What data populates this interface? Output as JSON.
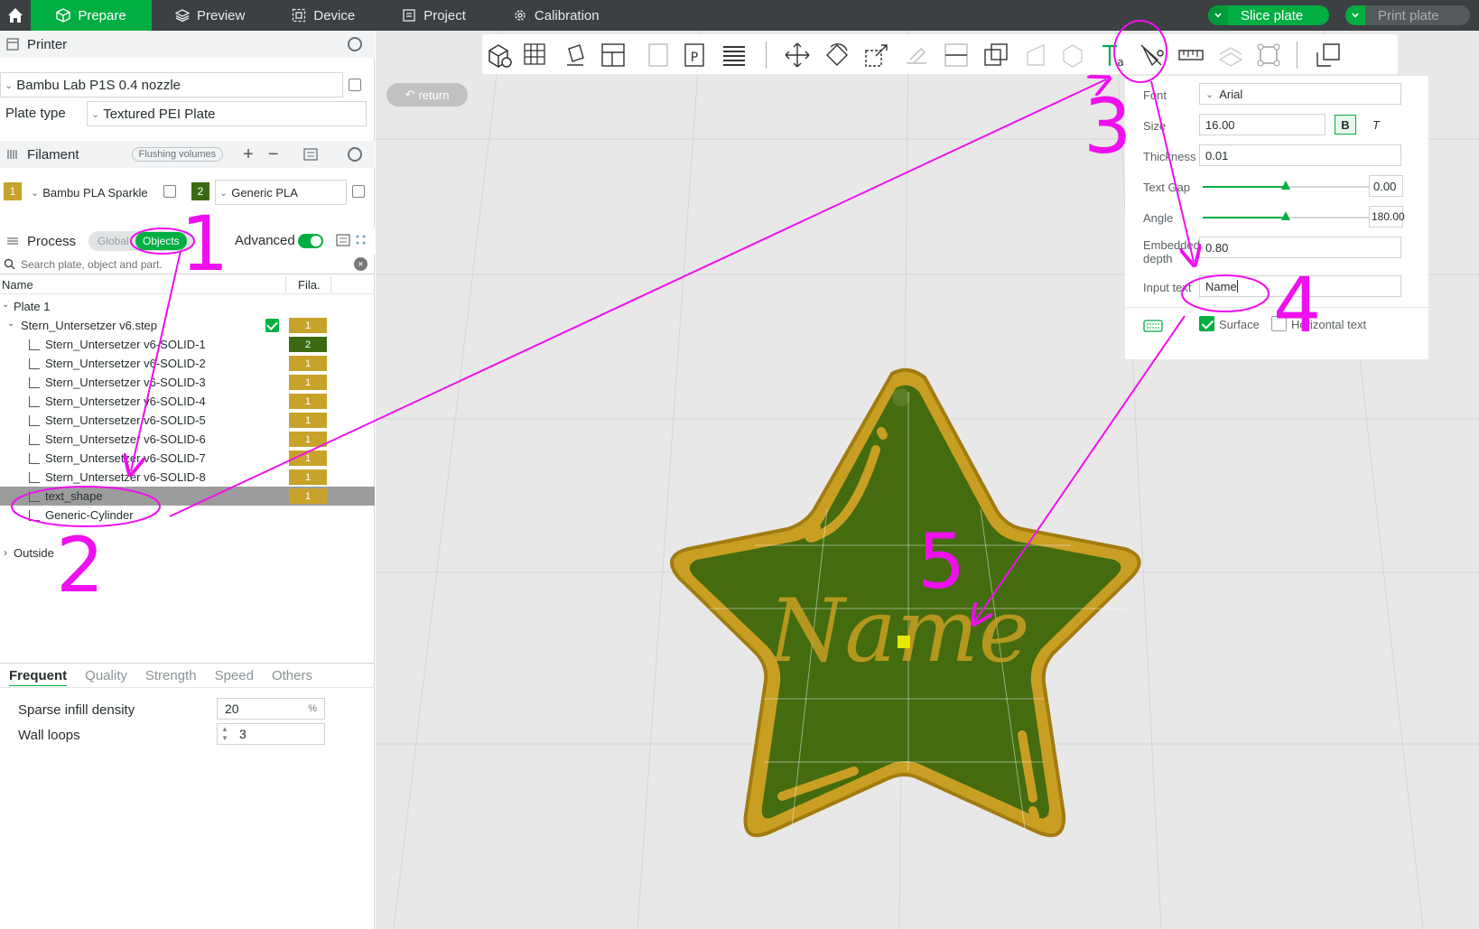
{
  "topbar": {
    "tabs": [
      {
        "label": "Prepare",
        "icon": "cube-icon"
      },
      {
        "label": "Preview",
        "icon": "layers-icon"
      },
      {
        "label": "Device",
        "icon": "device-icon"
      },
      {
        "label": "Project",
        "icon": "project-icon"
      },
      {
        "label": "Calibration",
        "icon": "calibration-icon"
      }
    ],
    "slice_label": "Slice plate",
    "print_label": "Print plate"
  },
  "printer": {
    "section_label": "Printer",
    "preset": "Bambu Lab P1S 0.4 nozzle",
    "plate_type_label": "Plate type",
    "plate_type": "Textured PEI Plate"
  },
  "filament": {
    "section_label": "Filament",
    "flushing_label": "Flushing volumes",
    "slots": [
      {
        "index": "1",
        "name": "Bambu PLA Sparkle",
        "color": "#c8a32a"
      },
      {
        "index": "2",
        "name": "Generic PLA",
        "color": "#3c6a12"
      }
    ]
  },
  "process": {
    "section_label": "Process",
    "global_label": "Global",
    "objects_label": "Objects",
    "advanced_label": "Advanced"
  },
  "search": {
    "placeholder": "Search plate, object and part."
  },
  "tree": {
    "col_name": "Name",
    "col_fila": "Fila.",
    "plate": "Plate 1",
    "object": {
      "name": "Stern_Untersetzer v6.step",
      "fila": "1"
    },
    "parts": [
      {
        "name": "Stern_Untersetzer v6-SOLID-1",
        "fila": "2"
      },
      {
        "name": "Stern_Untersetzer v6-SOLID-2",
        "fila": "1"
      },
      {
        "name": "Stern_Untersetzer v6-SOLID-3",
        "fila": "1"
      },
      {
        "name": "Stern_Untersetzer v6-SOLID-4",
        "fila": "1"
      },
      {
        "name": "Stern_Untersetzer v6-SOLID-5",
        "fila": "1"
      },
      {
        "name": "Stern_Untersetzer v6-SOLID-6",
        "fila": "1"
      },
      {
        "name": "Stern_Untersetzer v6-SOLID-7",
        "fila": "1"
      },
      {
        "name": "Stern_Untersetzer v6-SOLID-8",
        "fila": "1"
      },
      {
        "name": "text_shape",
        "fila": "1"
      },
      {
        "name": "Generic-Cylinder",
        "fila": ""
      }
    ],
    "outside": "Outside"
  },
  "settings": {
    "tabs": [
      "Frequent",
      "Quality",
      "Strength",
      "Speed",
      "Others"
    ],
    "params": [
      {
        "label": "Sparse infill density",
        "value": "20",
        "unit": "%"
      },
      {
        "label": "Wall loops",
        "value": "3",
        "unit": ""
      }
    ]
  },
  "viewport": {
    "return_label": "return",
    "model_text": "Name"
  },
  "text_tool": {
    "font_label": "Font",
    "font_value": "Arial",
    "size_label": "Size",
    "size_value": "16.00",
    "bold_label": "B",
    "italic_label": "T",
    "thickness_label": "Thickness",
    "thickness_value": "0.01",
    "gap_label": "Text Gap",
    "gap_value": "0.00",
    "gap_fraction": 0.5,
    "angle_label": "Angle",
    "angle_value": "180.00",
    "angle_fraction": 0.5,
    "embedded_label_1": "Embedded",
    "embedded_label_2": "depth",
    "embedded_value": "0.80",
    "input_label": "Input text",
    "input_value": "Name",
    "surface_label": "Surface",
    "surface_checked": true,
    "horizontal_label": "Horizontal text",
    "horizontal_checked": false
  },
  "annotations": [
    "1",
    "2",
    "3",
    "4",
    "5"
  ]
}
